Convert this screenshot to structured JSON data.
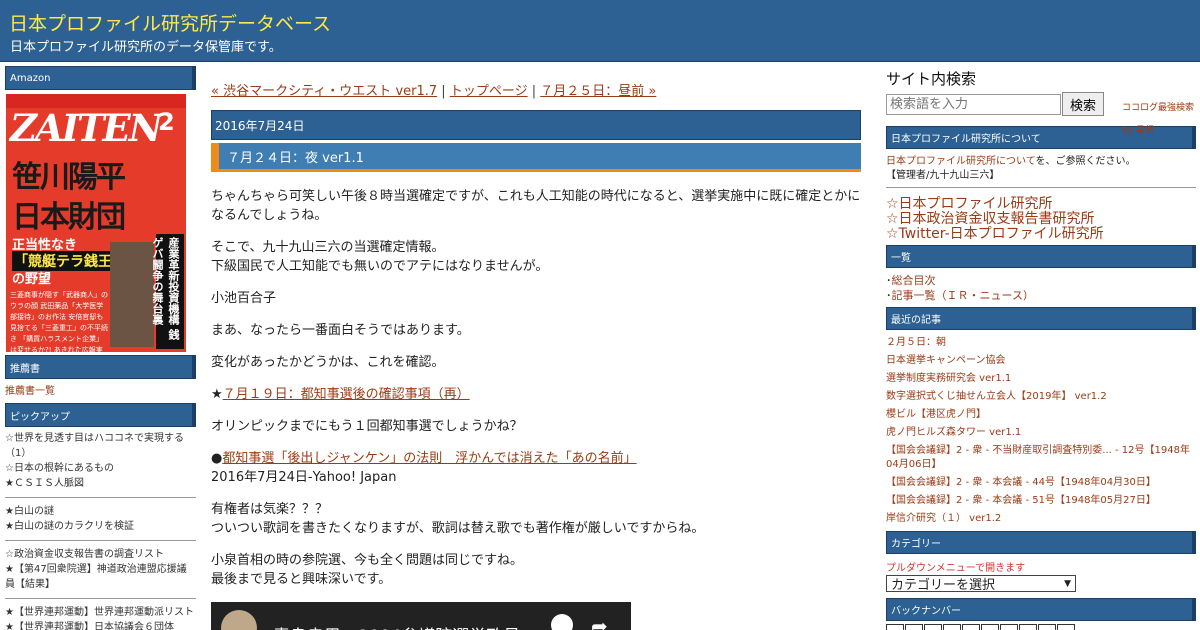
{
  "header": {
    "title": "日本プロファイル研究所データベース",
    "description": "日本プロファイル研究所のデータ保管庫です。"
  },
  "left": {
    "amazon_label": "Amazon",
    "ad": {
      "magazine": "ZAITEN",
      "issue": "2",
      "headline1": "笹川陽平",
      "headline2": "日本財団",
      "sub1": "正当性なき",
      "sub2": "「競艇テラ銭王国」",
      "sub3": "の野望",
      "vertical": "産業革新投資機構 銭ゲバ闘争の舞台裏",
      "lines": "三菱商事が隠す「武器商人」のウラの顔 武田薬品「大学医学部接待」のお作法 安倍官邸も見捨てる「三菱重工」の不平続き 「購買ハラスメント企業」は変せるか?! あきれた広報実態大賞は「長水製薬」に決定!"
    },
    "books_label": "推薦書",
    "books_link": "推薦書一覧",
    "pickup_label": "ピックアップ",
    "pickup_group1": [
      "☆世界を見透す目はハココネで実現する（1）",
      "☆日本の根幹にあるもの",
      "★ＣＳＩＳ人脈図"
    ],
    "pickup_group2": [
      "★白山の謎",
      "★白山の謎のカラクリを検証"
    ],
    "pickup_group3": [
      "☆政治資金収支報告書の調査リスト",
      "★【第47回衆院選】神道政治連盟応援議員【結果】"
    ],
    "pickup_group4": [
      "★【世界連邦運動】世界連邦運動派リスト",
      "★【世界連邦運動】日本協議会６団体"
    ]
  },
  "main": {
    "nav_prev": "« 渋谷マークシティ・ウエスト ver1.7",
    "nav_sep1": "|",
    "nav_top": "トップページ",
    "nav_sep2": "|",
    "nav_next": "７月２５日：昼前 »",
    "date": "2016年7月24日",
    "entry_title": "７月２４日：夜 ver1.1",
    "p1": "ちゃんちゃら可笑しい午後８時当選確定ですが、これも人工知能の時代になると、選挙実施中に既に確定とかになるんでしょうね。",
    "p2a": "そこで、九十九山三六の当選確定情報。",
    "p2b": "下級国民で人工知能でも無いのでアテにはなりませんが。",
    "p3": "小池百合子",
    "p4": "まあ、なったら一番面白そうではあります。",
    "p5": "変化があったかどうかは、これを確認。",
    "p6_star": "★",
    "p6_link": "７月１９日：都知事選後の確認事項（再）",
    "p7": "オリンピックまでにもう１回都知事選でしょうかね？",
    "p8_dot": "●",
    "p8_link": "都知事選「後出しジャンケン」の法則　浮かんでは消えた「あの名前」",
    "p8b": "2016年7月24日-Yahoo! Japan",
    "p9a": "有権者は気楽？？？",
    "p9b": "ついつい歌詞を書きたくなりますが、歌詞は替え歌でも著作権が厳しいですからね。",
    "p10a": "小泉首相の時の参院選、今も全く問題は同じですね。",
    "p10b": "最後まで見ると興味深いです。",
    "video_title": "青島幸男　2004参議院選挙政見..."
  },
  "right": {
    "search_title": "サイト内検索",
    "search_placeholder": "検索語を入力",
    "search_button": "検索",
    "search_credit": "ココログ最強検索 by 暴想",
    "about_label": "日本プロファイル研究所について",
    "about_link": "日本プロファイル研究所について",
    "about_text": "を、ご参照ください。",
    "about_admin": "【管理者/九十九山三六】",
    "big_links": [
      "☆日本プロファイル研究所",
      "☆日本政治資金収支報告書研究所",
      "☆Twitter-日本プロファイル研究所"
    ],
    "index_label": "一覧",
    "index_items": [
      "総合目次",
      "記事一覧（ＩＲ・ニュース）"
    ],
    "recent_label": "最近の記事",
    "recent_items": [
      "２月５日：朝",
      "日本選挙キャンペーン協会",
      "選挙制度実務研究会 ver1.1",
      "数字選択式くじ抽せん立会人【2019年】 ver1.2",
      "櫻ビル【港区虎ノ門】",
      "虎ノ門ヒルズ森タワー ver1.1",
      "【国会会議録】2 - 衆 - 不当財産取引調査特別委... - 12号【1948年04月06日】",
      "【国会会議録】2 - 衆 - 本会議 - 44号【1948年04月30日】",
      "【国会会議録】2 - 衆 - 本会議 - 51号【1948年05月27日】",
      "岸信介研究（１） ver1.2"
    ],
    "category_label": "カテゴリー",
    "category_note": "プルダウンメニューで開きます",
    "category_select": "カテゴリーを選択",
    "backnumber_label": "バックナンバー"
  }
}
